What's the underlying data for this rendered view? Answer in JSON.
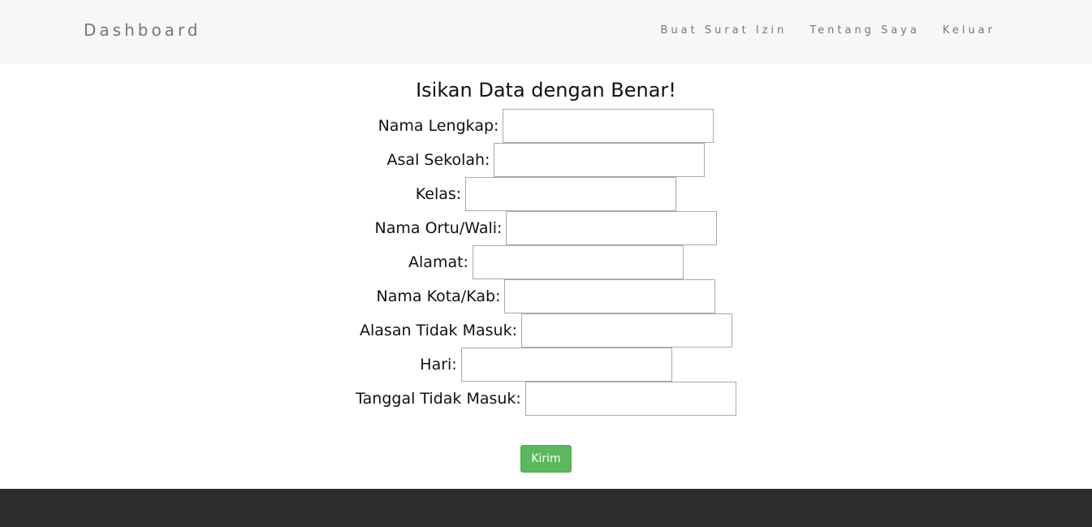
{
  "navbar": {
    "brand": "Dashboard",
    "links": [
      "Buat Surat Izin",
      "Tentang Saya",
      "Keluar"
    ]
  },
  "form": {
    "title": "Isikan Data dengan Benar!",
    "fields": [
      {
        "label": "Nama Lengkap:",
        "value": ""
      },
      {
        "label": "Asal Sekolah:",
        "value": ""
      },
      {
        "label": "Kelas:",
        "value": ""
      },
      {
        "label": "Nama Ortu/Wali:",
        "value": ""
      },
      {
        "label": "Alamat:",
        "value": ""
      },
      {
        "label": "Nama Kota/Kab:",
        "value": ""
      },
      {
        "label": "Alasan Tidak Masuk:",
        "value": ""
      },
      {
        "label": "Hari:",
        "value": ""
      },
      {
        "label": "Tanggal Tidak Masuk:",
        "value": ""
      }
    ],
    "submit_label": "Kirim"
  },
  "colors": {
    "navbar_bg": "#f7f7f7",
    "submit_bg": "#5cb85c",
    "footer_bg": "#2d2d2d"
  }
}
